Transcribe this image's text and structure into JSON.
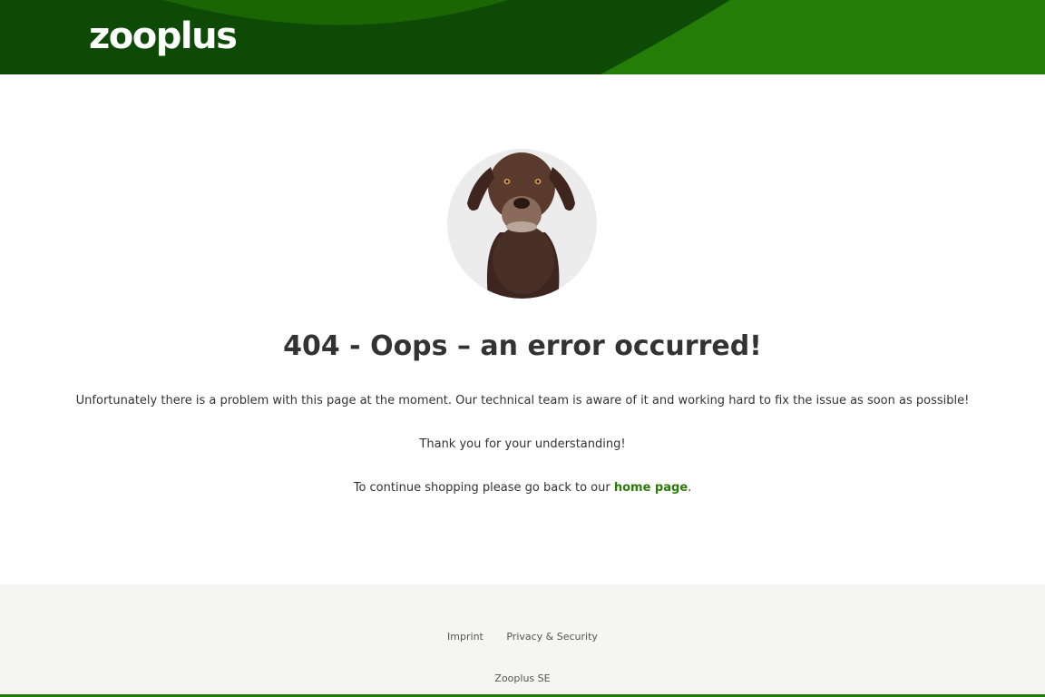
{
  "header": {
    "logo_text": "zooplus",
    "colors": {
      "dark_green": "#0c4a06",
      "mid_green": "#1a6605",
      "bright_green": "#247d06"
    }
  },
  "main": {
    "image": {
      "icon": "dog-photo",
      "alt": "404 dog"
    },
    "title": "404 - Oops – an error occurred!",
    "paragraph_1": "Unfortunately there is a problem with this page at the moment. Our technical team is aware of it and working hard to fix the issue as soon as possible!",
    "paragraph_2": "Thank you for your understanding!",
    "paragraph_3_prefix": "To continue shopping please go back to our ",
    "home_link_label": "home page",
    "paragraph_3_suffix": "."
  },
  "footer": {
    "links": [
      {
        "label": "Imprint"
      },
      {
        "label": "Privacy & Security"
      }
    ],
    "company": "Zooplus SE",
    "colors": {
      "background": "#f5f5f4",
      "bottom_line": "#1f7a0a"
    }
  }
}
